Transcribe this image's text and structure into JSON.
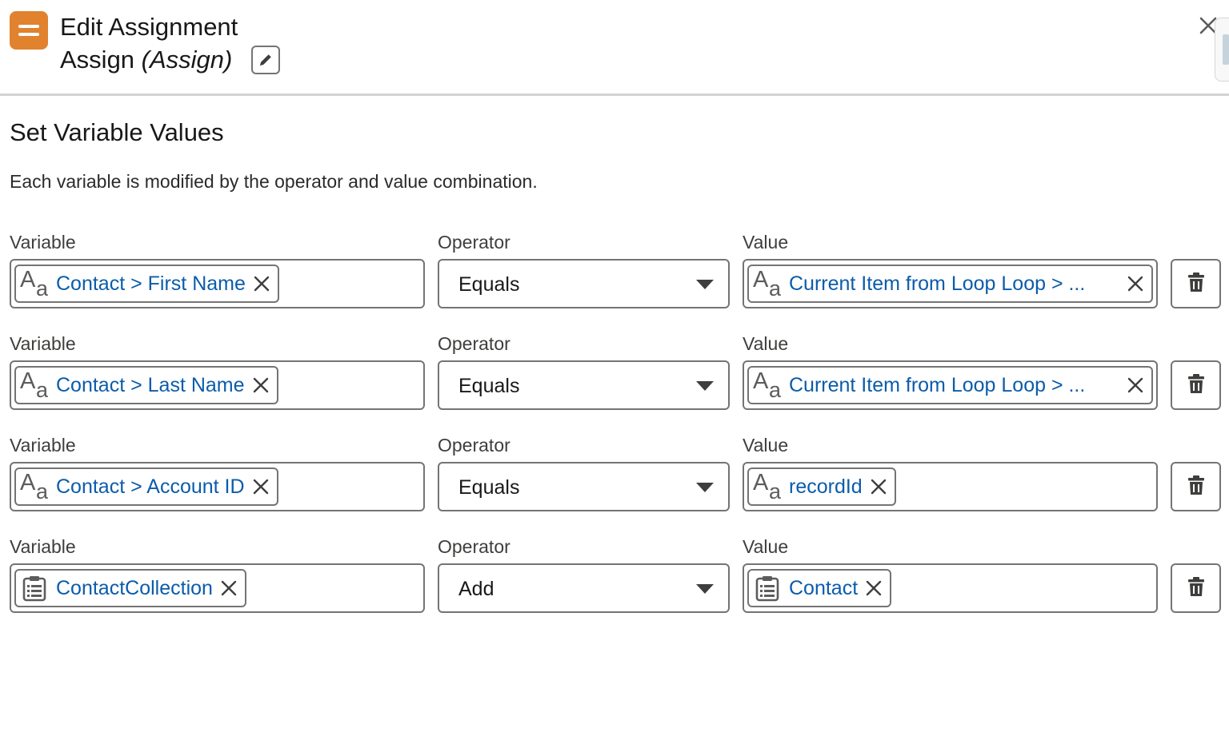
{
  "header": {
    "icon": "assignment-icon",
    "title": "Edit Assignment",
    "element_label": "Assign",
    "element_api_name": "(Assign)",
    "edit_icon": "pencil-icon",
    "close_icon": "close-icon"
  },
  "section": {
    "title": "Set Variable Values",
    "description": "Each variable is modified by the operator and value combination."
  },
  "labels": {
    "variable": "Variable",
    "operator": "Operator",
    "value": "Value"
  },
  "rows": [
    {
      "variable": {
        "text": "Contact > First Name",
        "icon": "text-type-icon"
      },
      "operator": "Equals",
      "value": {
        "text": "Current Item from Loop Loop > ...",
        "icon": "text-type-icon"
      }
    },
    {
      "variable": {
        "text": "Contact > Last Name",
        "icon": "text-type-icon"
      },
      "operator": "Equals",
      "value": {
        "text": "Current Item from Loop Loop > ...",
        "icon": "text-type-icon"
      }
    },
    {
      "variable": {
        "text": "Contact > Account ID",
        "icon": "text-type-icon"
      },
      "operator": "Equals",
      "value": {
        "text": "recordId",
        "icon": "text-type-icon"
      }
    },
    {
      "variable": {
        "text": "ContactCollection",
        "icon": "collection-icon"
      },
      "operator": "Add",
      "value": {
        "text": "Contact",
        "icon": "collection-icon"
      }
    }
  ],
  "colors": {
    "accent": "#e1822e",
    "link": "#0b5cab",
    "border": "#747474"
  }
}
